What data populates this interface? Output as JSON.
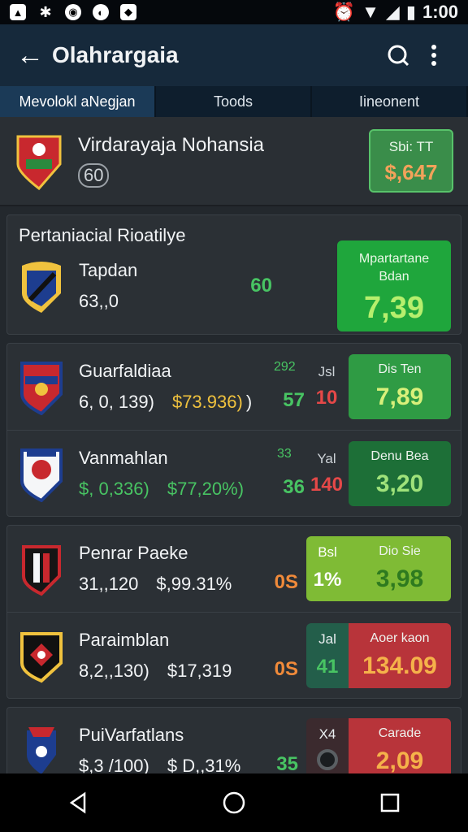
{
  "status": {
    "time": "1:00"
  },
  "appbar": {
    "title": "Olahrargaia"
  },
  "tabs": [
    {
      "label": "Mevolokl aNegjan"
    },
    {
      "label": "Toods"
    },
    {
      "label": "Iineonent"
    }
  ],
  "hero": {
    "name": "Virdarayaja Nohansia",
    "sub": "60",
    "card_top": "Sbi: TT",
    "card_value": "$,647"
  },
  "group1": {
    "title": "Pertaniacial Rioatilye",
    "rows": [
      {
        "name": "Tapdan",
        "stat1": "63,,0",
        "num": "60",
        "card_top": "Mpartartane",
        "card_mid": "Bdan",
        "card_value": "7,39"
      }
    ]
  },
  "group2": {
    "rows": [
      {
        "name": "Guarfaldiaa",
        "tag": "292",
        "stat1": "6, 0, 139)",
        "stat2": "$73.936)",
        "stat2_suffix": ")",
        "num": "57",
        "mid_k": "Jsl",
        "mid_v": "10",
        "card_top": "Dis Ten",
        "card_value": "7,89"
      },
      {
        "name": "Vanmahlan",
        "tag": "33",
        "stat1": "$, 0,336)",
        "stat2": "$77,20%)",
        "num": "36",
        "mid_k": "Yal",
        "mid_v": "140",
        "card_top": "Denu Bea",
        "card_value": "3,20"
      }
    ]
  },
  "group3": {
    "rows": [
      {
        "name": "Penrar Paeke",
        "stat1": "31,,120",
        "stat2": "$,99.31%",
        "num": "0S",
        "mid_k": "Bsl",
        "mid_v": "1%",
        "card_top": "Dio Sie",
        "card_value": "3,98"
      },
      {
        "name": "Paraimblan",
        "stat1": "8,2,,130)",
        "stat2": "$17,319",
        "num": "0S",
        "mid_k": "Jal",
        "mid_v": "41",
        "card_top": "Aoer kaon",
        "card_value": "134.09"
      }
    ]
  },
  "group4": {
    "rows": [
      {
        "name": "PuiVarfatlans",
        "stat1": "$,3 /100)",
        "stat2": "$ D,,31%",
        "num": "35",
        "mid_k": "X4",
        "card_top": "Carade",
        "card_value": "2,09"
      }
    ]
  }
}
